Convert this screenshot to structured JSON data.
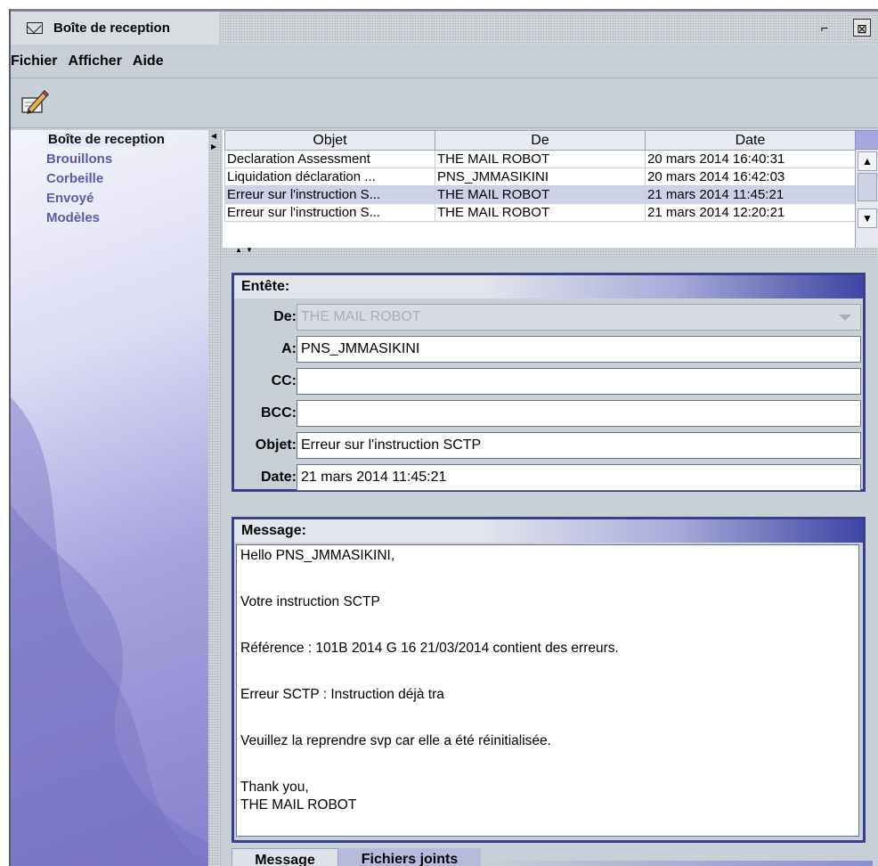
{
  "window": {
    "title": "Boîte de reception",
    "restore_symbol": "⌐",
    "close_symbol": "⊠"
  },
  "menu": [
    "Fichier",
    "Afficher",
    "Aide"
  ],
  "toolbar": {
    "compose_icon": "pencil-icon"
  },
  "sidebar": {
    "items": [
      {
        "label": "Boîte de reception",
        "selected": true
      },
      {
        "label": "Brouillons"
      },
      {
        "label": "Corbeille"
      },
      {
        "label": "Envoyé"
      },
      {
        "label": "Modèles"
      }
    ]
  },
  "table": {
    "columns": [
      "Objet",
      "De",
      "Date"
    ],
    "rows": [
      {
        "objet": "Declaration Assessment",
        "de": "THE MAIL ROBOT",
        "date": "20 mars 2014 16:40:31"
      },
      {
        "objet": "Liquidation déclaration ...",
        "de": "PNS_JMMASIKINI",
        "date": "20 mars 2014 16:42:03"
      },
      {
        "objet": "Erreur sur l'instruction S...",
        "de": "THE MAIL ROBOT",
        "date": "21 mars 2014 11:45:21",
        "selected": true
      },
      {
        "objet": "Erreur sur l'instruction S...",
        "de": "THE MAIL ROBOT",
        "date": "21 mars 2014 12:20:21"
      }
    ]
  },
  "header_panel": {
    "title": "Entête:",
    "de_label": "De:",
    "de_value": "THE MAIL ROBOT",
    "a_label": "A:",
    "a_value": "PNS_JMMASIKINI",
    "cc_label": "CC:",
    "cc_value": "",
    "bcc_label": "BCC:",
    "bcc_value": "",
    "objet_label": "Objet:",
    "objet_value": "Erreur sur l'instruction SCTP",
    "date_label": "Date:",
    "date_value": "21 mars 2014 11:45:21"
  },
  "message_panel": {
    "title": "Message:",
    "lines": {
      "l1": "Hello PNS_JMMASIKINI,",
      "l2": "Votre instruction SCTP",
      "l3": "Référence : 101B 2014 G 16 21/03/2014 contient des erreurs.",
      "l4": "Erreur SCTP : Instruction déjà tra",
      "l5": "Veuillez la reprendre svp car elle a été réinitialisée.",
      "l6": "Thank you,",
      "l7": "THE MAIL ROBOT"
    }
  },
  "tabs": {
    "message": "Message",
    "attachments": "Fichiers joints"
  },
  "colors": {
    "accent": "#3a3f8a",
    "selection": "#ced2e6",
    "folder_text": "#5c5aa8"
  }
}
